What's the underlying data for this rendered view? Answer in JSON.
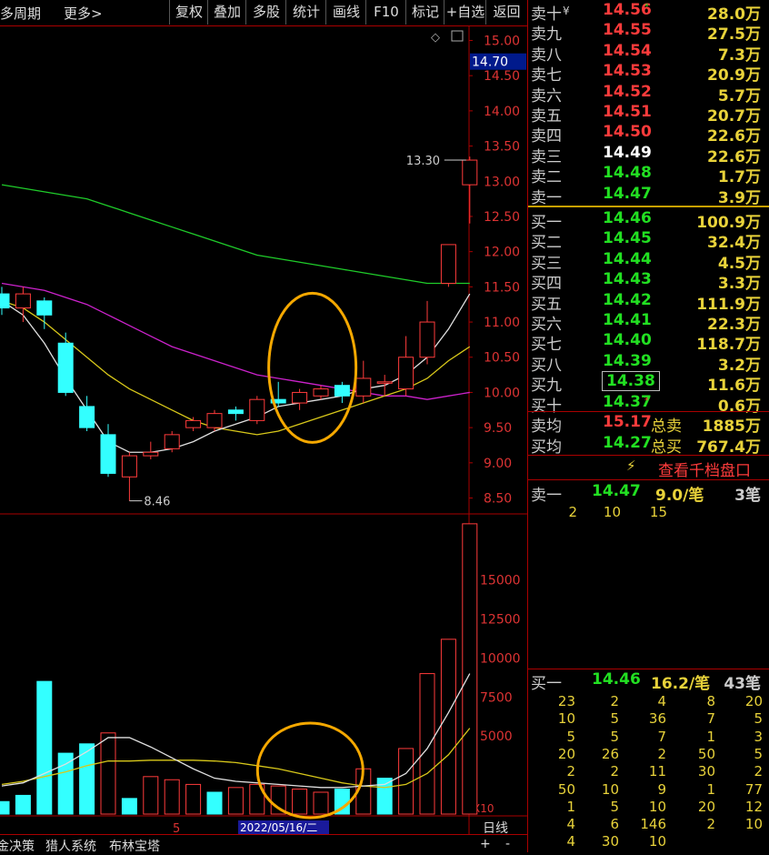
{
  "toolbar": {
    "period": "多周期",
    "more": "更多>",
    "buttons": [
      "复权",
      "叠加",
      "多股",
      "统计",
      "画线",
      "F10",
      "标记",
      "+自选",
      "返回"
    ]
  },
  "price_axis": [
    "15.00",
    "14.50",
    "14.00",
    "13.50",
    "13.00",
    "12.50",
    "12.00",
    "11.50",
    "11.00",
    "10.50",
    "10.00",
    "9.50",
    "9.00",
    "8.50"
  ],
  "current_price_tag": "14.70",
  "high_label": "13.30",
  "low_label": "8.46",
  "volume_axis": [
    "15000",
    "12500",
    "10000",
    "7500",
    "5000"
  ],
  "volume_unit": "X10",
  "date_marker": "5",
  "date_cursor": "2022/05/16/二",
  "day_line": "日线",
  "bottom_tabs": [
    "金决策",
    "猎人系统",
    "布林宝塔"
  ],
  "bottom_right": [
    "+",
    "-"
  ],
  "asks": [
    {
      "label": "卖十",
      "price": "14.56",
      "vol": "28.0万",
      "mark": "¥",
      "submark": "*"
    },
    {
      "label": "卖九",
      "price": "14.55",
      "vol": "27.5万"
    },
    {
      "label": "卖八",
      "price": "14.54",
      "vol": "7.3万"
    },
    {
      "label": "卖七",
      "price": "14.53",
      "vol": "20.9万"
    },
    {
      "label": "卖六",
      "price": "14.52",
      "vol": "5.7万"
    },
    {
      "label": "卖五",
      "price": "14.51",
      "vol": "20.7万"
    },
    {
      "label": "卖四",
      "price": "14.50",
      "vol": "22.6万"
    },
    {
      "label": "卖三",
      "price": "14.49",
      "vol": "22.6万"
    },
    {
      "label": "卖二",
      "price": "14.48",
      "vol": "1.7万"
    },
    {
      "label": "卖一",
      "price": "14.47",
      "vol": "3.9万"
    }
  ],
  "bids": [
    {
      "label": "买一",
      "price": "14.46",
      "vol": "100.9万"
    },
    {
      "label": "买二",
      "price": "14.45",
      "vol": "32.4万"
    },
    {
      "label": "买三",
      "price": "14.44",
      "vol": "4.5万"
    },
    {
      "label": "买四",
      "price": "14.43",
      "vol": "3.3万"
    },
    {
      "label": "买五",
      "price": "14.42",
      "vol": "111.9万"
    },
    {
      "label": "买六",
      "price": "14.41",
      "vol": "22.3万"
    },
    {
      "label": "买七",
      "price": "14.40",
      "vol": "118.7万"
    },
    {
      "label": "买八",
      "price": "14.39",
      "vol": "3.2万"
    },
    {
      "label": "买九",
      "price": "14.38",
      "vol": "11.6万"
    },
    {
      "label": "买十",
      "price": "14.37",
      "vol": "0.6万",
      "mark": "*"
    }
  ],
  "avg": {
    "sell_avg_label": "卖均",
    "sell_avg": "15.17",
    "sell_total_label": "总卖",
    "sell_total": "1885万",
    "buy_avg_label": "买均",
    "buy_avg": "14.27",
    "buy_total_label": "总买",
    "buy_total": "767.4万"
  },
  "thousand_link": "查看千档盘口",
  "sell_queue": {
    "label": "卖一",
    "price": "14.47",
    "per": "9.0/笔",
    "count": "3笔",
    "orders": [
      "2",
      "10",
      "15"
    ]
  },
  "buy_queue": {
    "label": "买一",
    "price": "14.46",
    "per": "16.2/笔",
    "count": "43笔",
    "orders": [
      [
        "23",
        "2",
        "4",
        "8",
        "20"
      ],
      [
        "10",
        "5",
        "36",
        "7",
        "5"
      ],
      [
        "5",
        "5",
        "7",
        "1",
        "3"
      ],
      [
        "20",
        "26",
        "2",
        "50",
        "5"
      ],
      [
        "2",
        "2",
        "11",
        "30",
        "2"
      ],
      [
        "50",
        "10",
        "9",
        "1",
        "77"
      ],
      [
        "1",
        "5",
        "10",
        "20",
        "12"
      ],
      [
        "4",
        "6",
        "146",
        "2",
        "10"
      ],
      [
        "4",
        "30",
        "10",
        "",
        ""
      ]
    ]
  },
  "chart_data": {
    "type": "candlestick",
    "ylim": [
      8.3,
      15.2
    ],
    "candles": [
      {
        "o": 11.4,
        "c": 11.2,
        "h": 11.5,
        "l": 11.1
      },
      {
        "o": 11.2,
        "c": 11.4,
        "h": 11.5,
        "l": 11.0
      },
      {
        "o": 11.3,
        "c": 11.1,
        "h": 11.35,
        "l": 10.9
      },
      {
        "o": 10.7,
        "c": 10.0,
        "h": 10.85,
        "l": 9.95
      },
      {
        "o": 9.8,
        "c": 9.5,
        "h": 9.95,
        "l": 9.45
      },
      {
        "o": 9.4,
        "c": 8.85,
        "h": 9.55,
        "l": 8.8
      },
      {
        "o": 8.8,
        "c": 9.1,
        "h": 9.15,
        "l": 8.46
      },
      {
        "o": 9.1,
        "c": 9.15,
        "h": 9.3,
        "l": 9.05
      },
      {
        "o": 9.2,
        "c": 9.4,
        "h": 9.45,
        "l": 9.15
      },
      {
        "o": 9.5,
        "c": 9.6,
        "h": 9.65,
        "l": 9.45
      },
      {
        "o": 9.5,
        "c": 9.7,
        "h": 9.75,
        "l": 9.45
      },
      {
        "o": 9.75,
        "c": 9.7,
        "h": 9.8,
        "l": 9.6
      },
      {
        "o": 9.6,
        "c": 9.9,
        "h": 9.95,
        "l": 9.55
      },
      {
        "o": 9.9,
        "c": 9.85,
        "h": 10.15,
        "l": 9.8
      },
      {
        "o": 9.85,
        "c": 10.0,
        "h": 10.05,
        "l": 9.75
      },
      {
        "o": 9.95,
        "c": 10.05,
        "h": 10.1,
        "l": 9.9
      },
      {
        "o": 10.1,
        "c": 9.95,
        "h": 10.15,
        "l": 9.85
      },
      {
        "o": 9.95,
        "c": 10.2,
        "h": 10.45,
        "l": 9.85
      },
      {
        "o": 10.15,
        "c": 10.15,
        "h": 10.25,
        "l": 9.95
      },
      {
        "o": 10.05,
        "c": 10.5,
        "h": 10.8,
        "l": 9.95
      },
      {
        "o": 10.5,
        "c": 11.0,
        "h": 11.3,
        "l": 10.4
      },
      {
        "o": 11.55,
        "c": 12.1,
        "h": 12.1,
        "l": 11.5
      },
      {
        "o": 12.95,
        "c": 13.3,
        "h": 13.35,
        "l": 12.4
      }
    ],
    "ma_white": [
      11.3,
      11.1,
      10.7,
      10.2,
      9.75,
      9.3,
      9.15,
      9.15,
      9.2,
      9.3,
      9.45,
      9.55,
      9.65,
      9.8,
      9.85,
      9.9,
      9.95,
      10.05,
      10.1,
      10.25,
      10.5,
      10.9,
      11.4
    ],
    "ma_yellow": [
      11.3,
      11.2,
      11.0,
      10.75,
      10.5,
      10.25,
      10.05,
      9.9,
      9.75,
      9.6,
      9.5,
      9.45,
      9.4,
      9.45,
      9.55,
      9.65,
      9.75,
      9.85,
      9.95,
      10.05,
      10.2,
      10.45,
      10.65
    ],
    "ma_magenta": [
      11.55,
      11.5,
      11.45,
      11.35,
      11.25,
      11.1,
      10.95,
      10.8,
      10.65,
      10.55,
      10.45,
      10.35,
      10.25,
      10.2,
      10.15,
      10.1,
      10.05,
      10.0,
      9.95,
      9.95,
      9.9,
      9.95,
      10.0
    ],
    "ma_green": [
      12.95,
      12.9,
      12.85,
      12.8,
      12.75,
      12.65,
      12.55,
      12.45,
      12.35,
      12.25,
      12.15,
      12.05,
      11.95,
      11.9,
      11.85,
      11.8,
      11.75,
      11.7,
      11.65,
      11.6,
      11.55,
      11.55,
      11.55
    ],
    "volumes": [
      800,
      1200,
      8500,
      3900,
      4500,
      5200,
      1000,
      2400,
      2200,
      1900,
      1400,
      1700,
      1900,
      1800,
      1600,
      1400,
      1600,
      2900,
      2300,
      4200,
      9000,
      11200,
      18600
    ],
    "vol_up": [
      false,
      false,
      false,
      false,
      false,
      true,
      false,
      true,
      true,
      true,
      false,
      true,
      true,
      true,
      true,
      true,
      false,
      true,
      false,
      true,
      true,
      true,
      true
    ],
    "vol_ma_white": [
      1800,
      2000,
      2600,
      3200,
      4000,
      4900,
      4900,
      4300,
      3600,
      2900,
      2300,
      2100,
      2000,
      1900,
      1800,
      1700,
      1700,
      1800,
      1900,
      2600,
      4200,
      6500,
      9000
    ],
    "vol_ma_yellow": [
      1900,
      2100,
      2400,
      2700,
      3100,
      3400,
      3400,
      3450,
      3450,
      3450,
      3400,
      3300,
      3100,
      2900,
      2600,
      2300,
      2000,
      1800,
      1700,
      1900,
      2600,
      3800,
      5500
    ],
    "vol_ylim": [
      0,
      19000
    ],
    "circles": [
      {
        "cx_candle": 14.6,
        "cy_price": 10.35
      },
      {
        "cx_candle": 14.5,
        "cy_vol": 2800
      }
    ]
  }
}
